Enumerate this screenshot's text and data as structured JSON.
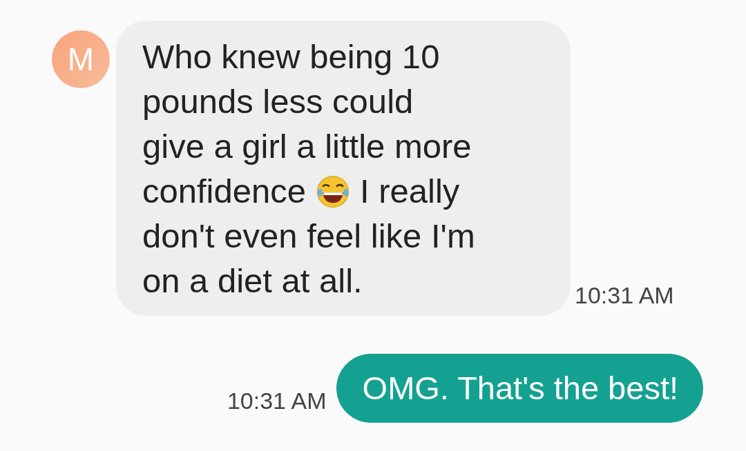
{
  "messages": [
    {
      "kind": "incoming",
      "avatar": "M",
      "lines": [
        [
          {
            "kind": "text",
            "text": "Who knew being 10"
          }
        ],
        [
          {
            "kind": "text",
            "text": "pounds less could"
          }
        ],
        [
          {
            "kind": "text",
            "text": "give a girl a little more"
          }
        ],
        [
          {
            "kind": "text",
            "text": "confidence"
          },
          {
            "kind": "emoji"
          },
          {
            "kind": "text",
            "text": "I really"
          }
        ],
        [
          {
            "kind": "text",
            "text": "don't even feel like I'm"
          }
        ],
        [
          {
            "kind": "text",
            "text": "on a diet at all."
          }
        ]
      ],
      "time": "10:31 AM"
    },
    {
      "kind": "outgoing",
      "lines": [
        [
          {
            "kind": "text",
            "text": "OMG. That's the best!"
          }
        ]
      ],
      "time": "10:31 AM"
    }
  ]
}
